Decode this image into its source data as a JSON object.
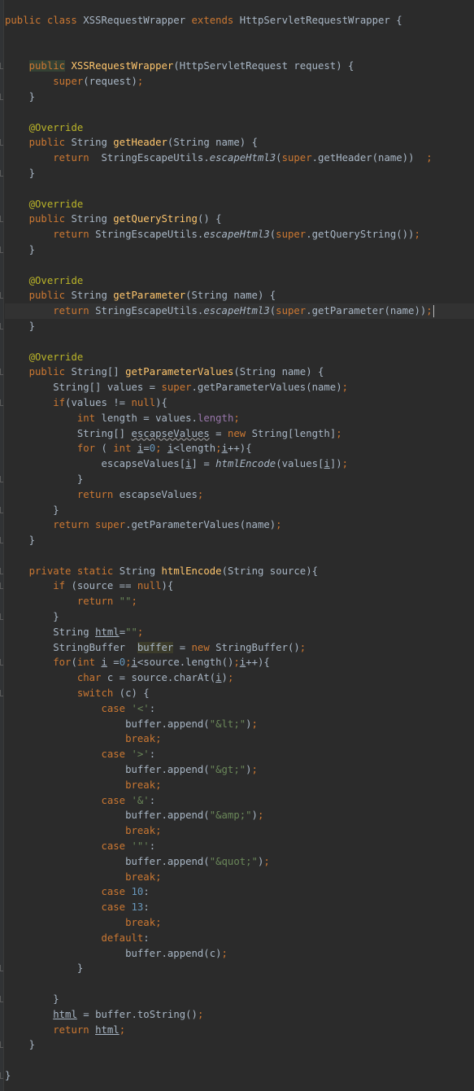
{
  "editor": {
    "language": "java",
    "theme": "Darcula",
    "colors": {
      "background": "#2b2b2b",
      "keyword": "#cc7832",
      "annotation": "#bbb529",
      "method_declaration": "#ffc66d",
      "string": "#6a8759",
      "number": "#6897bb",
      "field": "#9876aa",
      "text": "#a9b7c6"
    },
    "lines": [
      {
        "tokens": [
          [
            "kw",
            "public class "
          ],
          [
            "",
            "XSSRequestWrapper "
          ],
          [
            "kw",
            "extends "
          ],
          [
            "",
            "HttpServletRequestWrapper {"
          ]
        ]
      },
      {
        "tokens": []
      },
      {
        "tokens": []
      },
      {
        "tokens": [
          [
            "",
            "    "
          ],
          [
            "kw hl",
            "public"
          ],
          [
            "kw",
            " "
          ],
          [
            "fn",
            "XSSRequestWrapper"
          ],
          [
            "",
            "(HttpServletRequest request) {"
          ]
        ]
      },
      {
        "tokens": [
          [
            "",
            "        "
          ],
          [
            "kw",
            "super"
          ],
          [
            "",
            "(request)"
          ],
          [
            "kw",
            ";"
          ]
        ]
      },
      {
        "tokens": [
          [
            "",
            "    }"
          ]
        ]
      },
      {
        "tokens": []
      },
      {
        "tokens": [
          [
            "",
            "    "
          ],
          [
            "ann",
            "@Override"
          ]
        ]
      },
      {
        "tokens": [
          [
            "",
            "    "
          ],
          [
            "kw",
            "public "
          ],
          [
            "",
            "String "
          ],
          [
            "fn",
            "getHeader"
          ],
          [
            "",
            "(String name) {"
          ]
        ]
      },
      {
        "tokens": [
          [
            "",
            "        "
          ],
          [
            "kw",
            "return  "
          ],
          [
            "",
            "StringEscapeUtils."
          ],
          [
            "it",
            "escapeHtml3"
          ],
          [
            "",
            "("
          ],
          [
            "kw",
            "super"
          ],
          [
            "",
            ".getHeader(name))  "
          ],
          [
            "kw",
            ";"
          ]
        ]
      },
      {
        "tokens": [
          [
            "",
            "    }"
          ]
        ]
      },
      {
        "tokens": []
      },
      {
        "tokens": [
          [
            "",
            "    "
          ],
          [
            "ann",
            "@Override"
          ]
        ]
      },
      {
        "tokens": [
          [
            "",
            "    "
          ],
          [
            "kw",
            "public "
          ],
          [
            "",
            "String "
          ],
          [
            "fn",
            "getQueryString"
          ],
          [
            "",
            "() {"
          ]
        ]
      },
      {
        "tokens": [
          [
            "",
            "        "
          ],
          [
            "kw",
            "return "
          ],
          [
            "",
            "StringEscapeUtils."
          ],
          [
            "it",
            "escapeHtml3"
          ],
          [
            "",
            "("
          ],
          [
            "kw",
            "super"
          ],
          [
            "",
            ".getQueryString())"
          ],
          [
            "kw",
            ";"
          ]
        ]
      },
      {
        "tokens": [
          [
            "",
            "    }"
          ]
        ]
      },
      {
        "tokens": []
      },
      {
        "tokens": [
          [
            "",
            "    "
          ],
          [
            "ann",
            "@Override"
          ]
        ]
      },
      {
        "tokens": [
          [
            "",
            "    "
          ],
          [
            "kw",
            "public "
          ],
          [
            "",
            "String "
          ],
          [
            "fn",
            "getParameter"
          ],
          [
            "",
            "(String name) {"
          ]
        ]
      },
      {
        "current": true,
        "caret": true,
        "tokens": [
          [
            "",
            "        "
          ],
          [
            "kw",
            "return "
          ],
          [
            "",
            "StringEscapeUtils."
          ],
          [
            "it",
            "escapeHtml3"
          ],
          [
            "",
            "("
          ],
          [
            "kw",
            "super"
          ],
          [
            "",
            ".getParameter(name))"
          ],
          [
            "kw",
            ";"
          ]
        ]
      },
      {
        "tokens": [
          [
            "",
            "    }"
          ]
        ]
      },
      {
        "tokens": []
      },
      {
        "tokens": [
          [
            "",
            "    "
          ],
          [
            "ann",
            "@Override"
          ]
        ]
      },
      {
        "tokens": [
          [
            "",
            "    "
          ],
          [
            "kw",
            "public "
          ],
          [
            "",
            "String[] "
          ],
          [
            "fn",
            "getParameterValues"
          ],
          [
            "",
            "(String name) {"
          ]
        ]
      },
      {
        "tokens": [
          [
            "",
            "        String[] values = "
          ],
          [
            "kw",
            "super"
          ],
          [
            "",
            ".getParameterValues(name)"
          ],
          [
            "kw",
            ";"
          ]
        ]
      },
      {
        "tokens": [
          [
            "",
            "        "
          ],
          [
            "kw",
            "if"
          ],
          [
            "",
            "(values != "
          ],
          [
            "kw",
            "null"
          ],
          [
            "",
            "){"
          ]
        ]
      },
      {
        "tokens": [
          [
            "",
            "            "
          ],
          [
            "kw",
            "int "
          ],
          [
            "",
            "length = values."
          ],
          [
            "fld",
            "length"
          ],
          [
            "kw",
            ";"
          ]
        ]
      },
      {
        "tokens": [
          [
            "",
            "            String[] "
          ],
          [
            "wv",
            "escapseValues"
          ],
          [
            "",
            ""
          ],
          [
            "",
            " = "
          ],
          [
            "kw",
            "new "
          ],
          [
            "",
            "String[length]"
          ],
          [
            "kw",
            ";"
          ]
        ]
      },
      {
        "tokens": [
          [
            "",
            "            "
          ],
          [
            "kw",
            "for "
          ],
          [
            "",
            "( "
          ],
          [
            "kw",
            "int "
          ],
          [
            "ul",
            "i"
          ],
          [
            "",
            "="
          ],
          [
            "num",
            "0"
          ],
          [
            "kw",
            "; "
          ],
          [
            "ul",
            "i"
          ],
          [
            "",
            "<length"
          ],
          [
            "kw",
            ";"
          ],
          [
            "ul",
            "i"
          ],
          [
            "",
            "++){"
          ]
        ]
      },
      {
        "tokens": [
          [
            "",
            "                escapseValues["
          ],
          [
            "ul",
            "i"
          ],
          [
            "",
            "] = "
          ],
          [
            "it",
            "htmlEncode"
          ],
          [
            "",
            "(values["
          ],
          [
            "ul",
            "i"
          ],
          [
            "",
            "])"
          ],
          [
            "kw",
            ";"
          ]
        ]
      },
      {
        "tokens": [
          [
            "",
            "            }"
          ]
        ]
      },
      {
        "tokens": [
          [
            "",
            "            "
          ],
          [
            "kw",
            "return "
          ],
          [
            "",
            "escapseValues"
          ],
          [
            "kw",
            ";"
          ]
        ]
      },
      {
        "tokens": [
          [
            "",
            "        }"
          ]
        ]
      },
      {
        "tokens": [
          [
            "",
            "        "
          ],
          [
            "kw",
            "return super"
          ],
          [
            "",
            ".getParameterValues(name)"
          ],
          [
            "kw",
            ";"
          ]
        ]
      },
      {
        "tokens": [
          [
            "",
            "    }"
          ]
        ]
      },
      {
        "tokens": []
      },
      {
        "tokens": [
          [
            "",
            "    "
          ],
          [
            "kw",
            "private static "
          ],
          [
            "",
            "String "
          ],
          [
            "fn",
            "htmlEncode"
          ],
          [
            "",
            "(String source){"
          ]
        ]
      },
      {
        "tokens": [
          [
            "",
            "        "
          ],
          [
            "kw",
            "if "
          ],
          [
            "",
            "(source == "
          ],
          [
            "kw",
            "null"
          ],
          [
            "",
            "){"
          ]
        ]
      },
      {
        "tokens": [
          [
            "",
            "            "
          ],
          [
            "kw",
            "return "
          ],
          [
            "str",
            "\"\""
          ],
          [
            "kw",
            ";"
          ]
        ]
      },
      {
        "tokens": [
          [
            "",
            "        }"
          ]
        ]
      },
      {
        "tokens": [
          [
            "",
            "        String "
          ],
          [
            "ul",
            "html"
          ],
          [
            "",
            "="
          ],
          [
            "str",
            "\"\""
          ],
          [
            "kw",
            ";"
          ]
        ]
      },
      {
        "tokens": [
          [
            "",
            "        StringBuffer  "
          ],
          [
            "hlv",
            "buffer"
          ],
          [
            "",
            " = "
          ],
          [
            "kw",
            "new "
          ],
          [
            "",
            "StringBuffer()"
          ],
          [
            "kw",
            ";"
          ]
        ]
      },
      {
        "tokens": [
          [
            "",
            "        "
          ],
          [
            "kw",
            "for"
          ],
          [
            "",
            "("
          ],
          [
            "kw",
            "int "
          ],
          [
            "ul",
            "i"
          ],
          [
            "",
            " ="
          ],
          [
            "num",
            "0"
          ],
          [
            "kw",
            ";"
          ],
          [
            "ul",
            "i"
          ],
          [
            "",
            "<source.length()"
          ],
          [
            "kw",
            ";"
          ],
          [
            "ul",
            "i"
          ],
          [
            "",
            "++){"
          ]
        ]
      },
      {
        "tokens": [
          [
            "",
            "            "
          ],
          [
            "kw",
            "char "
          ],
          [
            "",
            "c = source.charAt("
          ],
          [
            "ul",
            "i"
          ],
          [
            "",
            ")"
          ],
          [
            "kw",
            ";"
          ]
        ]
      },
      {
        "tokens": [
          [
            "",
            "            "
          ],
          [
            "kw",
            "switch "
          ],
          [
            "",
            "(c) {"
          ]
        ]
      },
      {
        "tokens": [
          [
            "",
            "                "
          ],
          [
            "kw",
            "case "
          ],
          [
            "str",
            "'<'"
          ],
          [
            "",
            ":"
          ]
        ]
      },
      {
        "tokens": [
          [
            "",
            "                    buffer.append("
          ],
          [
            "str",
            "\"&lt;\""
          ],
          [
            "",
            ")"
          ],
          [
            "kw",
            ";"
          ]
        ]
      },
      {
        "tokens": [
          [
            "",
            "                    "
          ],
          [
            "kw",
            "break;"
          ]
        ]
      },
      {
        "tokens": [
          [
            "",
            "                "
          ],
          [
            "kw",
            "case "
          ],
          [
            "str",
            "'>'"
          ],
          [
            "",
            ":"
          ]
        ]
      },
      {
        "tokens": [
          [
            "",
            "                    buffer.append("
          ],
          [
            "str",
            "\"&gt;\""
          ],
          [
            "",
            ")"
          ],
          [
            "kw",
            ";"
          ]
        ]
      },
      {
        "tokens": [
          [
            "",
            "                    "
          ],
          [
            "kw",
            "break;"
          ]
        ]
      },
      {
        "tokens": [
          [
            "",
            "                "
          ],
          [
            "kw",
            "case "
          ],
          [
            "str",
            "'&'"
          ],
          [
            "",
            ":"
          ]
        ]
      },
      {
        "tokens": [
          [
            "",
            "                    buffer.append("
          ],
          [
            "str",
            "\"&amp;\""
          ],
          [
            "",
            ")"
          ],
          [
            "kw",
            ";"
          ]
        ]
      },
      {
        "tokens": [
          [
            "",
            "                    "
          ],
          [
            "kw",
            "break;"
          ]
        ]
      },
      {
        "tokens": [
          [
            "",
            "                "
          ],
          [
            "kw",
            "case "
          ],
          [
            "str",
            "'\"'"
          ],
          [
            "",
            ":"
          ]
        ]
      },
      {
        "tokens": [
          [
            "",
            "                    buffer.append("
          ],
          [
            "str",
            "\"&quot;\""
          ],
          [
            "",
            ")"
          ],
          [
            "kw",
            ";"
          ]
        ]
      },
      {
        "tokens": [
          [
            "",
            "                    "
          ],
          [
            "kw",
            "break;"
          ]
        ]
      },
      {
        "tokens": [
          [
            "",
            "                "
          ],
          [
            "kw",
            "case "
          ],
          [
            "num",
            "10"
          ],
          [
            "",
            ":"
          ]
        ]
      },
      {
        "tokens": [
          [
            "",
            "                "
          ],
          [
            "kw",
            "case "
          ],
          [
            "num",
            "13"
          ],
          [
            "",
            ":"
          ]
        ]
      },
      {
        "tokens": [
          [
            "",
            "                    "
          ],
          [
            "kw",
            "break;"
          ]
        ]
      },
      {
        "tokens": [
          [
            "",
            "                "
          ],
          [
            "kw",
            "default"
          ],
          [
            "",
            ":"
          ]
        ]
      },
      {
        "tokens": [
          [
            "",
            "                    buffer.append(c)"
          ],
          [
            "kw",
            ";"
          ]
        ]
      },
      {
        "tokens": [
          [
            "",
            "            }"
          ]
        ]
      },
      {
        "tokens": []
      },
      {
        "tokens": [
          [
            "",
            "        }"
          ]
        ]
      },
      {
        "tokens": [
          [
            "",
            "        "
          ],
          [
            "ul",
            "html"
          ],
          [
            "",
            " = buffer.toString()"
          ],
          [
            "kw",
            ";"
          ]
        ]
      },
      {
        "tokens": [
          [
            "",
            "        "
          ],
          [
            "kw",
            "return "
          ],
          [
            "ul",
            "html"
          ],
          [
            "kw",
            ";"
          ]
        ]
      },
      {
        "tokens": [
          [
            "",
            "    }"
          ]
        ]
      },
      {
        "tokens": []
      },
      {
        "tokens": [
          [
            "",
            "}"
          ]
        ]
      }
    ]
  }
}
